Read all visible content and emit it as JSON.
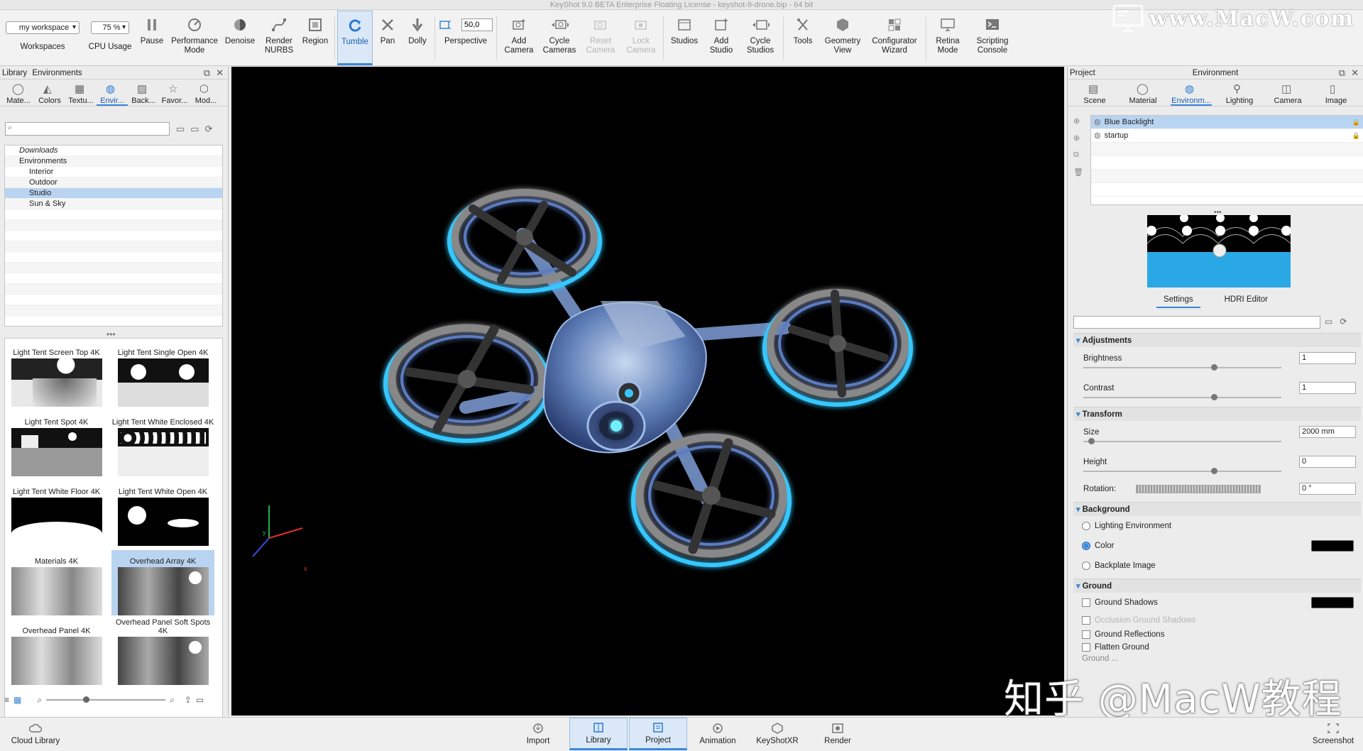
{
  "window": {
    "title": "KeyShot 9.0 BETA Enterprise Floating License  - keyshot-9-drone.bip  - 64 bit"
  },
  "watermark": {
    "top": "www.MacW.com",
    "bottom": "知乎 @MacW教程"
  },
  "toolbar": {
    "workspace_value": "my workspace",
    "workspaces_label": "Workspaces",
    "cpu_value": "75 %",
    "cpu_label": "CPU Usage",
    "pause": "Pause",
    "performance": "Performance Mode",
    "denoise": "Denoise",
    "render_nurbs": "Render NURBS",
    "region": "Region",
    "tumble": "Tumble",
    "pan": "Pan",
    "dolly": "Dolly",
    "fov_value": "50,0",
    "perspective": "Perspective",
    "add_camera": "Add Camera",
    "cycle_cameras": "Cycle Cameras",
    "reset_camera": "Reset Camera",
    "lock_camera": "Lock Camera",
    "studios": "Studios",
    "add_studio": "Add Studio",
    "cycle_studios": "Cycle Studios",
    "tools": "Tools",
    "geometry_view": "Geometry View",
    "configurator_wizard": "Configurator Wizard",
    "retina_mode": "Retina Mode",
    "scripting_console": "Scripting Console"
  },
  "library": {
    "header_left": "Library",
    "header_center": "Environments",
    "tabs": [
      "Mate...",
      "Colors",
      "Textu...",
      "Envir...",
      "Back...",
      "Favor...",
      "Mod..."
    ],
    "tree": [
      {
        "label": "Downloads",
        "indent": 0
      },
      {
        "label": "Environments",
        "indent": 0
      },
      {
        "label": "Interior",
        "indent": 1
      },
      {
        "label": "Outdoor",
        "indent": 1
      },
      {
        "label": "Studio",
        "indent": 1
      },
      {
        "label": "Sun & Sky",
        "indent": 1
      }
    ],
    "thumbnails": [
      "Light Tent Screen Top 4K",
      "Light Tent Single Open 4K",
      "Light Tent Spot 4K",
      "Light Tent White Enclosed 4K",
      "Light Tent White Floor 4K",
      "Light Tent White Open 4K",
      "Materials 4K",
      "Overhead Array 4K",
      "Overhead Panel 4K",
      "Overhead Panel Soft Spots 4K"
    ],
    "selected_thumbnail": "Overhead Array 4K",
    "cloud_library": "Cloud Library"
  },
  "project": {
    "header_left": "Project",
    "header_center": "Environment",
    "tabs": [
      "Scene",
      "Material",
      "Environm...",
      "Lighting",
      "Camera",
      "Image"
    ],
    "environments": [
      "Blue Backlight",
      "startup"
    ],
    "subtabs": [
      "Settings",
      "HDRI Editor"
    ],
    "adjustments": {
      "title": "Adjustments",
      "brightness_label": "Brightness",
      "brightness": "1",
      "contrast_label": "Contrast",
      "contrast": "1"
    },
    "transform": {
      "title": "Transform",
      "size_label": "Size",
      "size": "2000 mm",
      "height_label": "Height",
      "height": "0",
      "rotation_label": "Rotation:",
      "rotation": "0 °"
    },
    "background": {
      "title": "Background",
      "options": [
        "Lighting Environment",
        "Color",
        "Backplate Image"
      ],
      "selected": "Color",
      "color": "#000000"
    },
    "ground": {
      "title": "Ground",
      "options": [
        "Ground Shadows",
        "Occlusion Ground Shadows",
        "Ground Reflections",
        "Flatten Ground"
      ],
      "partial_row": "Ground ..."
    }
  },
  "bottombar": {
    "import": "Import",
    "library": "Library",
    "project": "Project",
    "animation": "Animation",
    "keyshotxr": "KeyShotXR",
    "render": "Render",
    "screenshot": "Screenshot"
  },
  "axes": {
    "x": "x",
    "y": "y"
  },
  "colors": {
    "accent": "#3a86d8",
    "selection": "#b9d4f1",
    "glow": "#35c8ff"
  }
}
